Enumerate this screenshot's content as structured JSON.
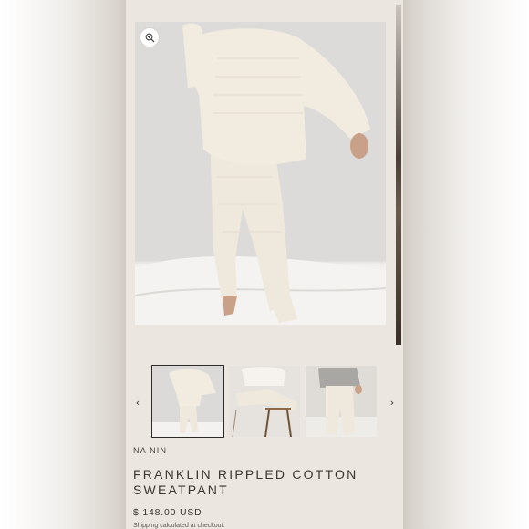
{
  "product": {
    "brand": "NA NIN",
    "title": "FRANKLIN RIPPLED COTTON SWEATPANT",
    "price": "$ 148.00 USD",
    "shipping_note": "Shipping calculated at checkout."
  },
  "gallery": {
    "zoom_icon": "zoom-in-icon",
    "prev_icon": "chevron-left-icon",
    "next_icon": "chevron-right-icon",
    "prev_glyph": "‹",
    "next_glyph": "›",
    "thumbnails": [
      {
        "subject": "sweatshirt-and-sweatpant-standing",
        "selected": true
      },
      {
        "subject": "seated-on-chair",
        "selected": false
      },
      {
        "subject": "sweatpant-with-grey-top",
        "selected": false
      }
    ]
  },
  "colors": {
    "panel_bg": "#ebe6df",
    "garment": "#efe8dc",
    "text": "#3b3631"
  }
}
